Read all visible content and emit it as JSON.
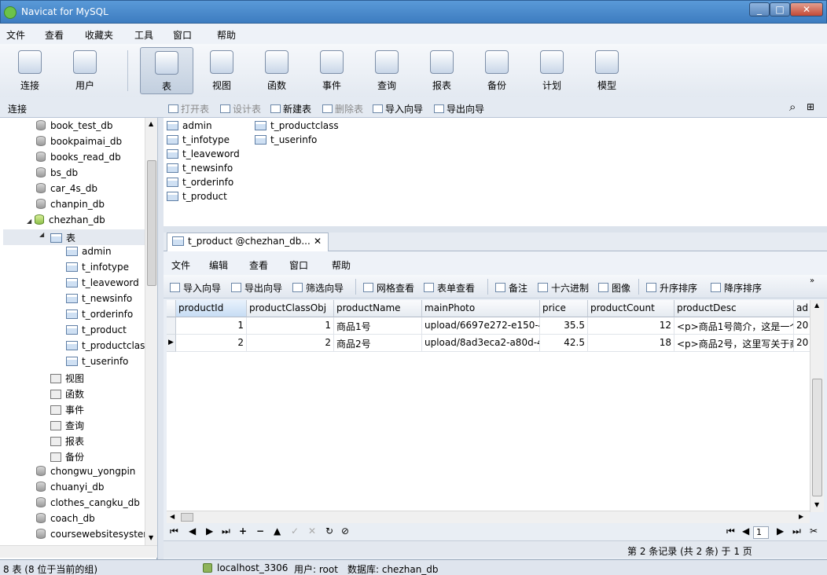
{
  "window": {
    "title": "Navicat for MySQL",
    "min": "_",
    "restore": "□",
    "close": "✕"
  },
  "menu": [
    "文件",
    "查看",
    "收藏夹",
    "工具",
    "窗口",
    "帮助"
  ],
  "toolbar": {
    "buttons": [
      {
        "label": "连接",
        "icon": "plug-icon"
      },
      {
        "label": "用户",
        "icon": "user-icon"
      },
      {
        "label": "表",
        "icon": "table-icon",
        "active": true
      },
      {
        "label": "视图",
        "icon": "view-icon"
      },
      {
        "label": "函数",
        "icon": "function-icon"
      },
      {
        "label": "事件",
        "icon": "event-icon"
      },
      {
        "label": "查询",
        "icon": "query-icon"
      },
      {
        "label": "报表",
        "icon": "report-icon"
      },
      {
        "label": "备份",
        "icon": "backup-icon"
      },
      {
        "label": "计划",
        "icon": "schedule-icon"
      },
      {
        "label": "模型",
        "icon": "model-icon"
      }
    ]
  },
  "subbar": {
    "connection_label": "连接",
    "actions": [
      "打开表",
      "设计表",
      "新建表",
      "删除表",
      "导入向导",
      "导出向导"
    ]
  },
  "tree": {
    "databases_above": [
      "book_test_db",
      "bookpaimai_db",
      "books_read_db",
      "bs_db",
      "car_4s_db",
      "chanpin_db"
    ],
    "open_db": "chezhan_db",
    "tables_group": "表",
    "tables": [
      "admin",
      "t_infotype",
      "t_leaveword",
      "t_newsinfo",
      "t_orderinfo",
      "t_product",
      "t_productclass",
      "t_userinfo"
    ],
    "groups": [
      "视图",
      "函数",
      "事件",
      "查询",
      "报表",
      "备份"
    ],
    "databases_below": [
      "chongwu_yongpin",
      "chuanyi_db",
      "clothes_cangku_db",
      "coach_db",
      "coursewebsitesyster"
    ]
  },
  "object_list": {
    "col1": [
      "admin",
      "t_infotype",
      "t_leaveword",
      "t_newsinfo",
      "t_orderinfo",
      "t_product"
    ],
    "col2": [
      "t_productclass",
      "t_userinfo"
    ]
  },
  "tab": {
    "label": "t_product @chezhan_db...",
    "close": "✕"
  },
  "inner_menu": [
    "文件",
    "编辑",
    "查看",
    "窗口",
    "帮助"
  ],
  "inner_toolbar": [
    "导入向导",
    "导出向导",
    "筛选向导",
    "网格查看",
    "表单查看",
    "备注",
    "十六进制",
    "图像",
    "升序排序",
    "降序排序"
  ],
  "grid": {
    "columns": [
      "productId",
      "productClassObj",
      "productName",
      "mainPhoto",
      "price",
      "productCount",
      "productDesc",
      "ad"
    ],
    "rows": [
      [
        "1",
        "1",
        "商品1号",
        "upload/6697e272-e150-4",
        "35.5",
        "12",
        "<p>商品1号简介，这是一个",
        "20"
      ],
      [
        "2",
        "2",
        "商品2号",
        "upload/8ad3eca2-a80d-4",
        "42.5",
        "18",
        "<p>商品2号，这里写关于商",
        "20"
      ]
    ]
  },
  "nav": {
    "page": "1",
    "record_status": "第 2 条记录 (共 2 条) 于 1 页"
  },
  "status": {
    "left": "8 表 (8 位于当前的组)",
    "host": "localhost_3306",
    "user": "用户: root",
    "db": "数据库: chezhan_db"
  }
}
